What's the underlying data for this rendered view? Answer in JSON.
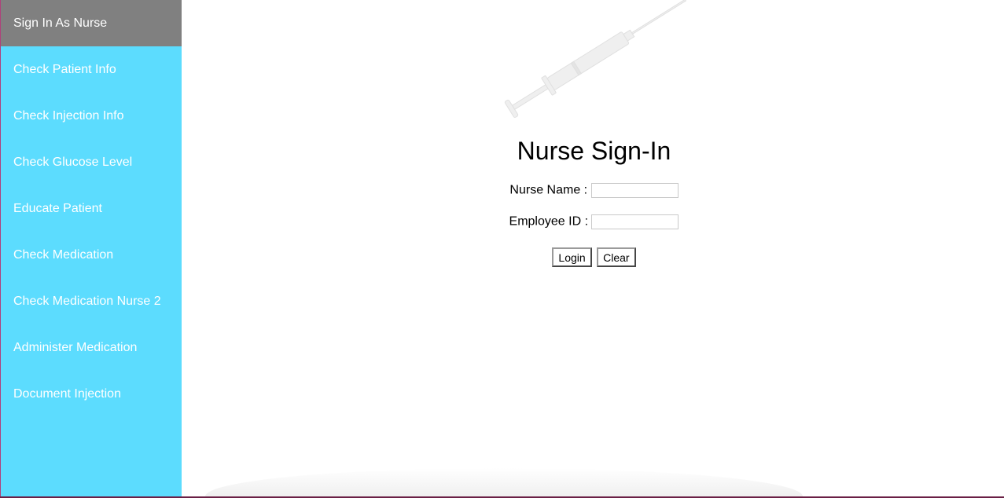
{
  "sidebar": {
    "items": [
      {
        "label": "Sign In As Nurse",
        "active": true
      },
      {
        "label": "Check Patient Info"
      },
      {
        "label": "Check Injection Info"
      },
      {
        "label": "Check Glucose Level"
      },
      {
        "label": "Educate Patient"
      },
      {
        "label": "Check Medication"
      },
      {
        "label": "Check Medication Nurse 2"
      },
      {
        "label": "Administer Medication"
      },
      {
        "label": "Document Injection"
      }
    ]
  },
  "main": {
    "title": "Nurse Sign-In",
    "illustration": "syringe-icon",
    "fields": [
      {
        "label": "Nurse Name :",
        "value": ""
      },
      {
        "label": "Employee ID :",
        "value": ""
      }
    ],
    "buttons": {
      "login": "Login",
      "clear": "Clear"
    }
  },
  "colors": {
    "sidebar_bg": "#5cdcfe",
    "active_bg": "#808080",
    "nav_text": "#ffffff"
  }
}
